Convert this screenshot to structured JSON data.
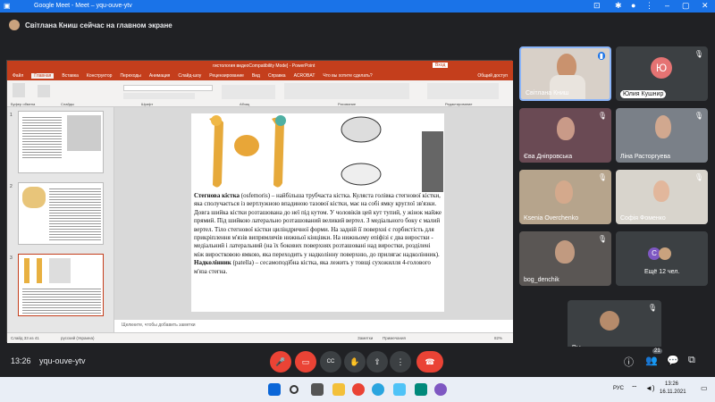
{
  "browser": {
    "tab_title": "Google Meet - Meet – yqu-ouve-ytv",
    "page_title": "Meet – yqu-ouve-ytv"
  },
  "banner": {
    "text": "Світлана Книш сейчас на главном экране"
  },
  "ppt": {
    "window_title": "гистология видеоCompatibility Mode] - PowerPoint",
    "tabs": [
      "Файл",
      "Главная",
      "Вставка",
      "Конструктор",
      "Переходы",
      "Анимация",
      "Слайд-шоу",
      "Рецензирование",
      "Вид",
      "Справка",
      "ACROBAT",
      "Что вы хотите сделать?"
    ],
    "share_label": "Общий доступ",
    "ribbon_groups": [
      "Буфер обмена",
      "Слайды",
      "Шрифт",
      "Абзац",
      "Рисование",
      "Редактирование"
    ],
    "thumb_numbers": [
      "1",
      "2",
      "3"
    ],
    "slide_paragraph_1_bold": "Стегнова кістка",
    "slide_paragraph_1": " (osfemoris) – найбільша трубчаста кістка. Куляста голівка стегнової кістки, яка сполучається із вертлужною впадиною тазової кістки, має на собі ямку круглої зв'язки. Довга шийка кістки розташована до неї під кутом. У чоловіків цей кут тупий, у жінок майже прямий. Під шийкою латерально розташований великий вертел. З медіального боку є малий вертел. Тіло стегнової кістки циліндричної форми. На задній її поверхні є горбистість для прикріплення м'язів випрямлячів нижньої кінцівки. На нижньому епіфізі є два виростки - медіальний і латеральний (на їх бокових поверхнях розташовані над виростки, розділені між виростковою ямкою, яка переходить у надколінну поверхню, до прилягає надколінник).",
    "slide_paragraph_2_bold": "Надколінник",
    "slide_paragraph_2": " (patella) – сесамоподібна кістка, яка лежить у товщі сухожилля 4-голового м'яза стегна.",
    "notes_placeholder": "Щелкните, чтобы добавить заметки",
    "status_slide": "Слайд 33 из 41",
    "status_lang": "русский (Украина)",
    "status_notes": "Заметки",
    "status_comments": "Примечания",
    "status_zoom": "82%"
  },
  "participants": [
    {
      "name": "Світлана Книш"
    },
    {
      "name": "Юлия Кушнир",
      "initials": "Ю"
    },
    {
      "name": "Єва Дніпровська"
    },
    {
      "name": "Ліна Расторгуева"
    },
    {
      "name": "Ksenia Overchenko"
    },
    {
      "name": "Софія Фоменко"
    },
    {
      "name": "bog_denchik"
    },
    {
      "name": "Ещё 12 чел.",
      "initials": "С"
    },
    {
      "name": "Вы"
    }
  ],
  "controls": {
    "time": "13:26",
    "meeting_code": "yqu-ouve-ytv",
    "cc_label": "CC",
    "people_count": "21"
  },
  "taskbar": {
    "lang": "РУС",
    "time": "13:26",
    "date": "16.11.2021"
  },
  "colors": {
    "ppt_accent": "#c43e1c",
    "meet_red": "#ea4335",
    "chrome_blue": "#1a73e8"
  }
}
